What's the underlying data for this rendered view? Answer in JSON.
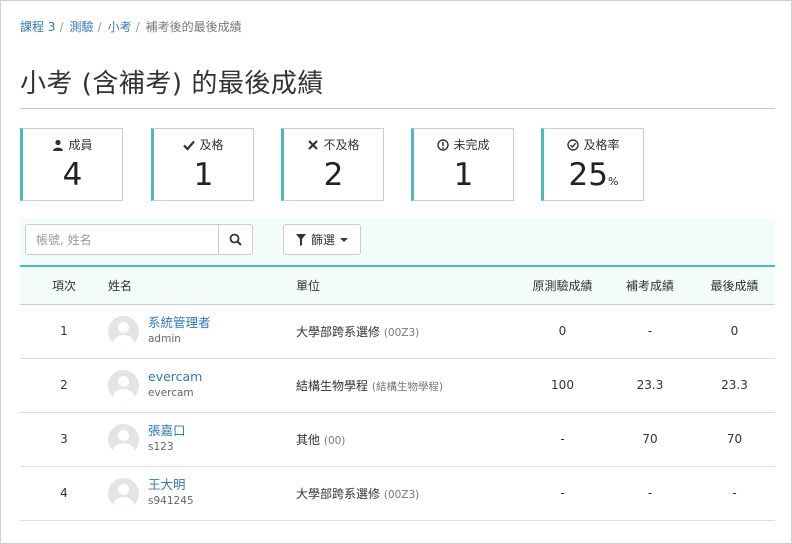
{
  "breadcrumb": [
    {
      "label": "課程 3"
    },
    {
      "label": "測驗"
    },
    {
      "label": "小考"
    }
  ],
  "breadcrumb_current": "補考後的最後成績",
  "page_title": "小考 (含補考) 的最後成績",
  "stats": {
    "members": {
      "icon": "user-icon",
      "label": "成員",
      "value": "4"
    },
    "passed": {
      "icon": "check-icon",
      "label": "及格",
      "value": "1"
    },
    "failed": {
      "icon": "x-icon",
      "label": "不及格",
      "value": "2"
    },
    "incomplete": {
      "icon": "exclamation-circle-icon",
      "label": "未完成",
      "value": "1"
    },
    "pass_rate": {
      "icon": "check-circle-icon",
      "label": "及格率",
      "value": "25",
      "unit": "%"
    }
  },
  "search": {
    "placeholder": "帳號, 姓名",
    "icon": "search-icon"
  },
  "filter": {
    "label": "篩選",
    "icon": "filter-icon"
  },
  "table": {
    "headers": {
      "index": "項次",
      "name": "姓名",
      "unit": "單位",
      "original": "原測驗成績",
      "makeup": "補考成績",
      "final": "最後成績"
    },
    "rows": [
      {
        "index": "1",
        "name": "系統管理者",
        "account": "admin",
        "unit": "大學部跨系選修",
        "unit_code": "(00Z3)",
        "original": "0",
        "makeup": "-",
        "final": "0"
      },
      {
        "index": "2",
        "name": "evercam",
        "account": "evercam",
        "unit": "結構生物學程",
        "unit_code": "(結構生物學程)",
        "original": "100",
        "makeup": "23.3",
        "final": "23.3"
      },
      {
        "index": "3",
        "name": "張嘉口",
        "account": "s123",
        "unit": "其他",
        "unit_code": "(00)",
        "original": "-",
        "makeup": "70",
        "final": "70"
      },
      {
        "index": "4",
        "name": "王大明",
        "account": "s941245",
        "unit": "大學部跨系選修",
        "unit_code": "(00Z3)",
        "original": "-",
        "makeup": "-",
        "final": "-"
      }
    ]
  },
  "colors": {
    "accent": "#4cb8b8",
    "link": "#337ab7",
    "fail": "#e02020",
    "toolbar_bg": "#f3fcfb"
  }
}
